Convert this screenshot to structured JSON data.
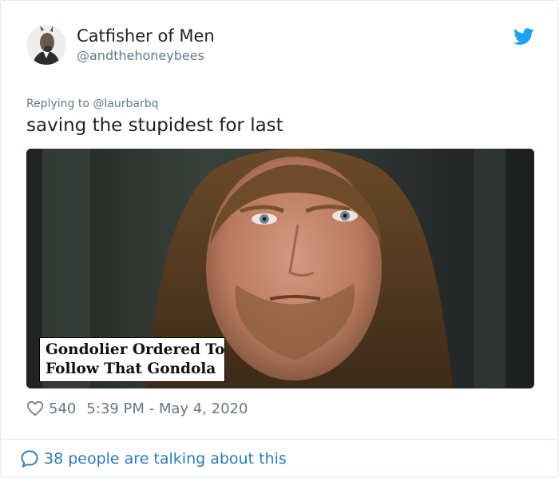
{
  "author": {
    "name": "Catfisher of Men",
    "handle": "@andthehoneybees"
  },
  "tweet": {
    "replying_to": "Replying to @laurbarbq",
    "text": "saving the stupidest for last",
    "media_caption": {
      "line1": "Gondolier Ordered To",
      "line2": "Follow That Gondola"
    }
  },
  "meta": {
    "likes": "540",
    "timestamp": "5:39 PM - May 4, 2020"
  },
  "footer": {
    "talking": "38 people are talking about this"
  },
  "icons": {
    "brand": "twitter-bird-icon",
    "like": "heart-icon",
    "conversation": "speech-bubble-icon"
  },
  "colors": {
    "brand": "#1da1f2",
    "link": "#2b7bb9",
    "secondary_text": "#697882",
    "primary_text": "#1c2022"
  }
}
